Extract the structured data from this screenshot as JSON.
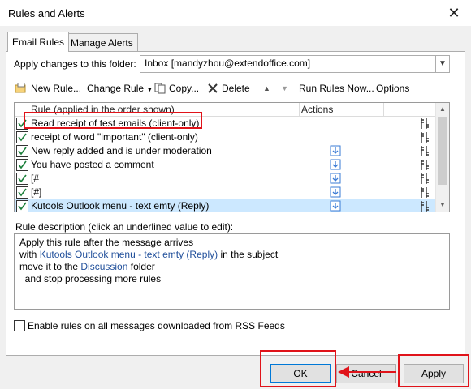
{
  "window": {
    "title": "Rules and Alerts"
  },
  "tabs": [
    {
      "label": "Email Rules",
      "active": true
    },
    {
      "label": "Manage Alerts",
      "active": false
    }
  ],
  "folder": {
    "label": "Apply changes to this folder:",
    "value": "Inbox [mandyzhou@extendoffice.com]"
  },
  "toolbar": {
    "new_rule": "New Rule...",
    "change_rule": "Change Rule",
    "copy": "Copy...",
    "delete": "Delete",
    "run_rules": "Run Rules Now...",
    "options": "Options"
  },
  "rules_list": {
    "col_rule": "Rule (applied in the order shown)",
    "col_actions": "Actions",
    "rows": [
      {
        "name": "Read receipt of test emails  (client-only)",
        "checked": true,
        "action_icon": false,
        "selected": false
      },
      {
        "name": "receipt of word \"important\"  (client-only)",
        "checked": true,
        "action_icon": false,
        "selected": false
      },
      {
        "name": "New reply added and is under moderation",
        "checked": true,
        "action_icon": true,
        "selected": false
      },
      {
        "name": "You have posted a comment",
        "checked": true,
        "action_icon": true,
        "selected": false
      },
      {
        "name": "[#",
        "checked": true,
        "action_icon": true,
        "selected": false
      },
      {
        "name": "[#]",
        "checked": true,
        "action_icon": true,
        "selected": false
      },
      {
        "name": "Kutools Outlook menu - text emty (Reply)",
        "checked": true,
        "action_icon": true,
        "selected": true
      }
    ]
  },
  "description": {
    "label": "Rule description (click an underlined value to edit):",
    "line1": "Apply this rule after the message arrives",
    "line2_prefix": "with ",
    "line2_link": "Kutools Outlook menu - text emty (Reply)",
    "line2_suffix": " in the subject",
    "line3_prefix": "move it to the ",
    "line3_link": "Discussion",
    "line3_suffix": " folder",
    "line4": "  and stop processing more rules"
  },
  "rss": {
    "label": "Enable rules on all messages downloaded from RSS Feeds",
    "checked": false
  },
  "buttons": {
    "ok": "OK",
    "cancel": "Cancel",
    "apply": "Apply"
  },
  "annotation_color": "#e0131a",
  "accent_color": "#0078d7"
}
